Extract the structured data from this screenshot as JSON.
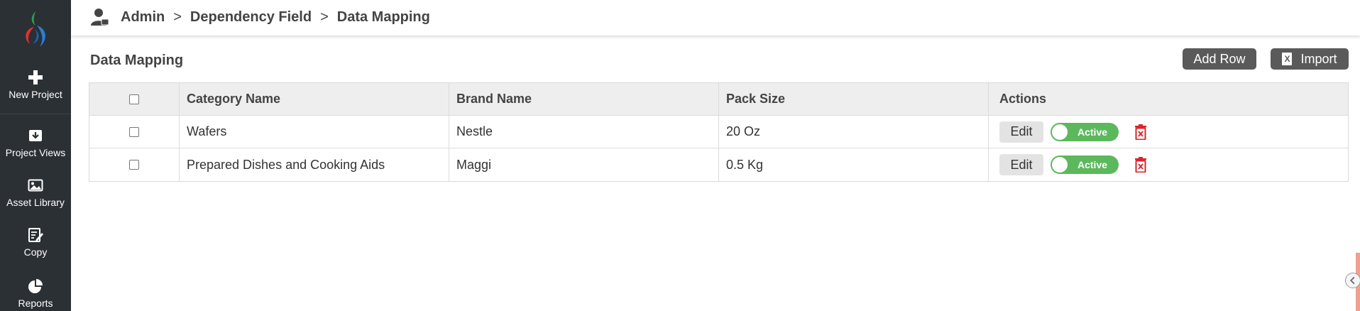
{
  "sidebar": {
    "items": [
      {
        "label": "New Project",
        "icon": "plus-icon"
      },
      {
        "label": "Project Views",
        "icon": "inbox-download-icon"
      },
      {
        "label": "Asset Library",
        "icon": "image-icon"
      },
      {
        "label": "Copy",
        "icon": "edit-document-icon"
      },
      {
        "label": "Reports",
        "icon": "pie-chart-icon"
      }
    ]
  },
  "header": {
    "breadcrumb": [
      "Admin",
      "Dependency Field",
      "Data Mapping"
    ],
    "separator": ">"
  },
  "main": {
    "title": "Data Mapping",
    "add_row_label": "Add Row",
    "import_label": "Import",
    "table": {
      "columns": [
        "Category Name",
        "Brand Name",
        "Pack Size",
        "Actions"
      ],
      "rows": [
        {
          "category": "Wafers",
          "brand": "Nestle",
          "pack": "20 Oz",
          "edit": "Edit",
          "status": "Active"
        },
        {
          "category": "Prepared Dishes and Cooking Aids",
          "brand": "Maggi",
          "pack": "0.5 Kg",
          "edit": "Edit",
          "status": "Active"
        }
      ]
    }
  },
  "colors": {
    "sidebar_bg": "#2b3035",
    "toggle_active": "#5cb85c",
    "delete_red": "#d9262c",
    "button_dark": "#5a5a5a"
  }
}
